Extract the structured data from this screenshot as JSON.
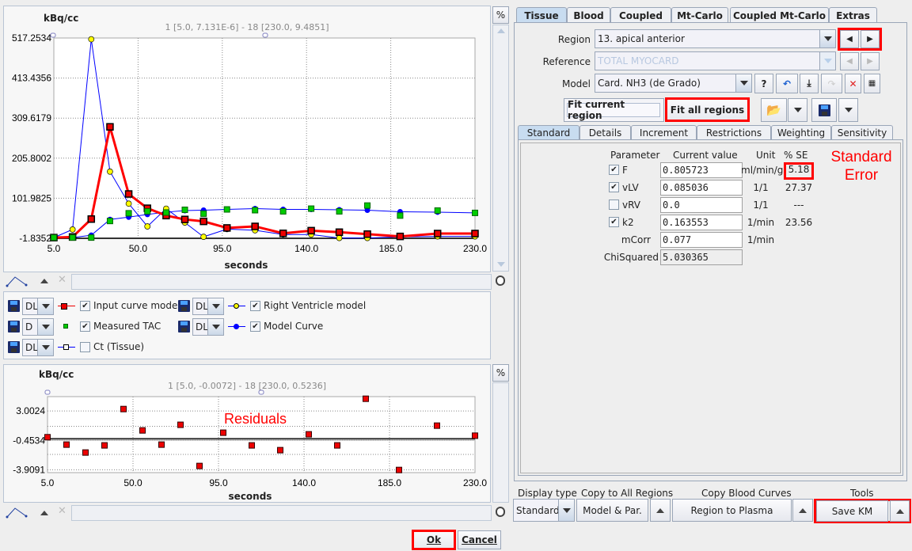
{
  "main_chart": {
    "y_unit": "kBq/cc",
    "range_info": "1 [5.0, 7.131E-6] - 18 [230.0, 9.4851]",
    "xlabel": "seconds",
    "percent_label": "%"
  },
  "residual_chart": {
    "y_unit": "kBq/cc",
    "range_info": "1 [5.0, -0.0072] - 18 [230.0, 0.5236]",
    "xlabel": "seconds",
    "annotation": "Residuals",
    "percent_label": "%"
  },
  "chart_data": [
    {
      "type": "line",
      "ylabel": "kBq/cc",
      "xlabel": "seconds",
      "xlim": [
        5.0,
        230.0
      ],
      "ylim": [
        -1.8352,
        517.2534
      ],
      "x_ticks": [
        "5.0",
        "50.0",
        "95.0",
        "140.0",
        "185.0",
        "230.0"
      ],
      "y_ticks": [
        "517.2534",
        "413.4356",
        "309.6179",
        "205.8002",
        "101.9825",
        "-1.8352"
      ],
      "grid": true,
      "x": [
        5,
        15,
        25,
        35,
        45,
        55,
        65,
        75,
        85,
        97.5,
        112.5,
        127.5,
        142.5,
        157.5,
        172.5,
        190,
        210,
        230
      ],
      "series": [
        {
          "name": "Input curve model",
          "color": "#ff0000",
          "marker": "square",
          "values": [
            0,
            1.6,
            48,
            287,
            113,
            76,
            57,
            47,
            42,
            25,
            29,
            11,
            18,
            14,
            9,
            3,
            10.5,
            10.5
          ]
        },
        {
          "name": "Right Ventricle model",
          "color": "#0000ff",
          "marker": "yellow-circle",
          "values": [
            0,
            21,
            514,
            171,
            88,
            29,
            75,
            39,
            2,
            22,
            19,
            8,
            8,
            -1,
            -1,
            2,
            3,
            3
          ]
        },
        {
          "name": "Measured TAC",
          "color": "#00cc00",
          "marker": "green-square",
          "values": [
            0,
            0,
            0,
            43,
            63,
            68,
            65,
            72,
            62,
            73,
            71,
            68,
            75,
            68,
            83,
            57,
            70,
            64
          ]
        },
        {
          "name": "Model Curve",
          "color": "#0000ff",
          "marker": "blue-circle",
          "values": [
            0,
            0,
            6,
            47,
            53,
            60,
            66,
            70,
            71,
            73,
            75,
            73,
            73,
            72,
            71,
            67,
            66,
            64
          ]
        }
      ]
    },
    {
      "type": "scatter",
      "ylabel": "kBq/cc",
      "xlabel": "seconds",
      "xlim": [
        5.0,
        230.0
      ],
      "ylim": [
        -4.24,
        4.69
      ],
      "x_ticks": [
        "5.0",
        "50.0",
        "95.0",
        "140.0",
        "185.0",
        "230.0"
      ],
      "y_ticks": [
        "3.0024",
        "-0.4534",
        "-3.9091"
      ],
      "grid": true,
      "x": [
        5,
        15,
        25,
        35,
        45,
        55,
        65,
        75,
        85,
        97.5,
        112.5,
        127.5,
        142.5,
        157.5,
        172.5,
        190,
        210,
        230
      ],
      "series": [
        {
          "name": "Residuals",
          "color": "#ff0000",
          "values": [
            -0.08,
            -0.95,
            -1.88,
            -1.04,
            3.23,
            0.72,
            -0.95,
            1.38,
            -3.46,
            0.45,
            -1.04,
            -1.6,
            0.26,
            -1.04,
            4.44,
            -3.93,
            1.28,
            0.1
          ]
        }
      ]
    }
  ],
  "legend": [
    {
      "mode": "DL",
      "label": "Input curve model",
      "checked": true
    },
    {
      "mode": "DL",
      "label": "Right Ventricle model",
      "checked": true
    },
    {
      "mode": "D",
      "label": "Measured TAC",
      "checked": true
    },
    {
      "mode": "DL",
      "label": "Model Curve",
      "checked": true
    },
    {
      "mode": "DL",
      "label": "Ct (Tissue)",
      "checked": false
    }
  ],
  "tabs": [
    "Tissue",
    "Blood",
    "Coupled",
    "Mt-Carlo",
    "Coupled Mt-Carlo",
    "Extras"
  ],
  "region": {
    "label": "Region",
    "value": "13. apical anterior"
  },
  "reference": {
    "label": "Reference",
    "value": "TOTAL MYOCARD"
  },
  "model": {
    "label": "Model",
    "value": "Card. NH3 (de Grado)",
    "help": "?"
  },
  "fit": {
    "current": "Fit current region",
    "all": "Fit all regions"
  },
  "subtabs": [
    "Standard",
    "Details",
    "Increment",
    "Restrictions",
    "Weighting",
    "Sensitivity"
  ],
  "params": {
    "headers": {
      "parameter": "Parameter",
      "value": "Current value",
      "unit": "Unit",
      "se": "% SE"
    },
    "rows": [
      {
        "name": "F",
        "checkbox": true,
        "checked": true,
        "value": "0.805723",
        "unit": "ml/min/g",
        "se": "5.18"
      },
      {
        "name": "vLV",
        "checkbox": true,
        "checked": true,
        "value": "0.085036",
        "unit": "1/1",
        "se": "27.37"
      },
      {
        "name": "vRV",
        "checkbox": true,
        "checked": false,
        "value": "0.0",
        "unit": "1/1",
        "se": "---"
      },
      {
        "name": "k2",
        "checkbox": true,
        "checked": true,
        "value": "0.163553",
        "unit": "1/min",
        "se": "23.56"
      },
      {
        "name": "mCorr",
        "checkbox": false,
        "value": "0.077",
        "unit": "1/min",
        "se": ""
      },
      {
        "name": "ChiSquared",
        "checkbox": false,
        "value": "5.030365",
        "unit": "",
        "se": ""
      }
    ],
    "annotation_line1": "Standard",
    "annotation_line2": "Error"
  },
  "bottom": {
    "display_type_label": "Display type",
    "display_type_value": "Standard",
    "copy_all_label": "Copy to All Regions",
    "copy_all_button": "Model & Par.",
    "copy_blood_label": "Copy Blood Curves",
    "copy_blood_button": "Region to Plasma",
    "tools_label": "Tools",
    "tools_button": "Save KM"
  },
  "dialog": {
    "ok": "Ok",
    "cancel": "Cancel"
  },
  "colors": {
    "highlight": "#ff0000",
    "tab_active": "#c8dcf0"
  }
}
